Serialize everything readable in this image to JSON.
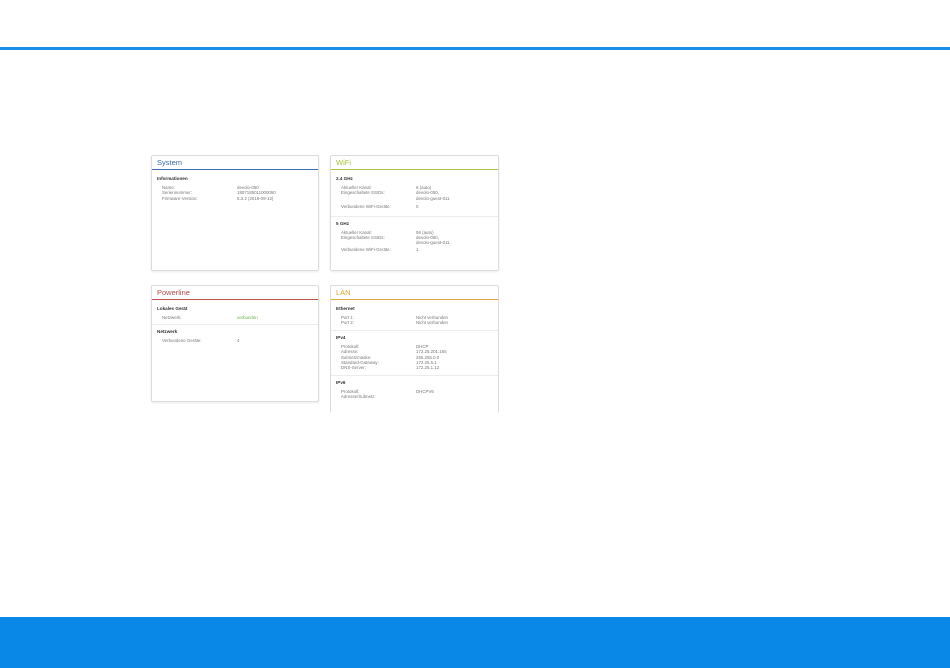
{
  "colors": {
    "top_rule": "#1a8ee6",
    "bottom_band": "#0a88e8",
    "system_accent": "#3b6db2",
    "wifi_accent": "#a7c43a",
    "powerline_accent": "#c0504d",
    "lan_accent": "#e5a73c",
    "connected_green": "#6ab04c"
  },
  "system": {
    "title": "System",
    "section": "Informationen",
    "rows": [
      {
        "label": "Name:",
        "value": "devolo-050"
      },
      {
        "label": "Seriennummer:",
        "value": "1807185011000050"
      },
      {
        "label": "Firmware-Version:",
        "value": "5.3.2 (2019-09-12)"
      }
    ]
  },
  "wifi": {
    "title": "WiFi",
    "band24": {
      "section": "2.4 GHz",
      "channel_label": "Aktueller Kanal:",
      "channel_value": "6 (auto)",
      "ssids_label": "Eingeschaltete SSIDs:",
      "ssid_1": "devolo-050,",
      "ssid_2": "devolo-guest-011",
      "devices_label": "Verbundene WiFi-Geräte:",
      "devices_value": "0"
    },
    "band5": {
      "section": "5 GHz",
      "channel_label": "Aktueller Kanal:",
      "channel_value": "56 (auto)",
      "ssids_label": "Eingeschaltete SSIDs:",
      "ssid_1": "devolo-050,",
      "ssid_2": "devolo-guest-011",
      "devices_label": "Verbundene WiFi-Geräte:",
      "devices_value": "1"
    }
  },
  "powerline": {
    "title": "Powerline",
    "local_section": "Lokales Gerät",
    "network_label": "Netzwerk:",
    "network_value": "verbunden",
    "network_section": "Netzwerk",
    "devices_label": "Verbundene Geräte:",
    "devices_value": "4"
  },
  "lan": {
    "title": "LAN",
    "ethernet": {
      "section": "Ethernet",
      "port1_label": "Port 1:",
      "port1_value": "Nicht verbunden",
      "port2_label": "Port 2:",
      "port2_value": "Nicht verbunden"
    },
    "ipv4": {
      "section": "IPv4",
      "rows": [
        {
          "label": "Protokoll:",
          "value": "DHCP"
        },
        {
          "label": "Adresse:",
          "value": "172.25.201.165"
        },
        {
          "label": "Subnetzmaske:",
          "value": "255.255.0.0"
        },
        {
          "label": "Standard-Gateway:",
          "value": "172.25.5.1"
        },
        {
          "label": "DNS-Server:",
          "value": "172.25.1.12"
        }
      ]
    },
    "ipv6": {
      "section": "IPv6",
      "protocol_label": "Protokoll:",
      "protocol_value": "DHCPV6",
      "address_label": "Adresse/Subnetz:"
    }
  }
}
